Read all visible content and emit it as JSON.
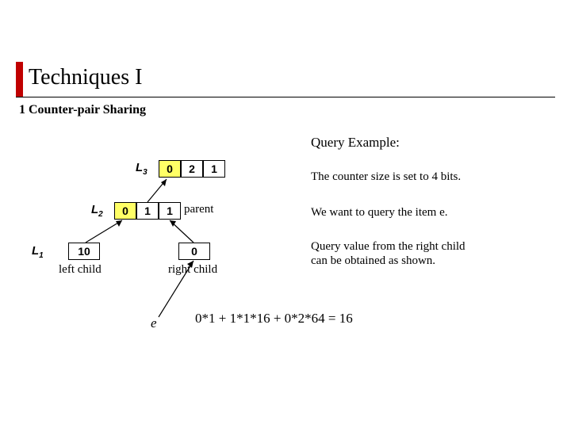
{
  "title": "Techniques  I",
  "subtitle": "1 Counter-pair Sharing",
  "heading_right": "Query Example:",
  "note1": "The counter size is set to 4 bits.",
  "note2": "We want to query the item e.",
  "note3a": "Query value from the right child",
  "note3b": "can be obtained as shown.",
  "levels": {
    "L3": {
      "label": "L",
      "sub": "3",
      "cells": [
        "0",
        "2",
        "1"
      ],
      "highlight": [
        0
      ]
    },
    "L2": {
      "label": "L",
      "sub": "2",
      "cells": [
        "0",
        "1",
        "1"
      ],
      "highlight": [
        0
      ],
      "annot": "parent"
    },
    "L1": {
      "label": "L",
      "sub": "1",
      "left": "10",
      "right": "0",
      "left_label": "left child",
      "right_label": "right child"
    }
  },
  "formula": "0*1 + 1*1*16 + 0*2*64 = 16",
  "item_label": "e"
}
